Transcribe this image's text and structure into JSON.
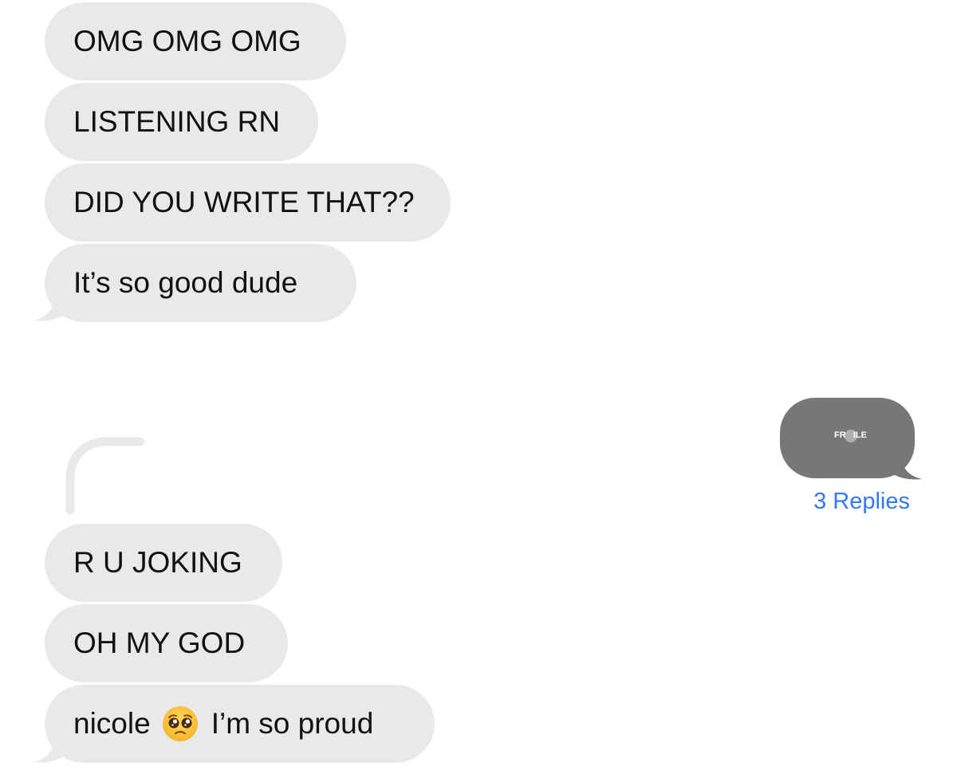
{
  "messages_group_1": [
    {
      "text": "OMG OMG OMG"
    },
    {
      "text": "LISTENING RN"
    },
    {
      "text": "DID YOU WRITE THAT??"
    },
    {
      "text": "It’s so good dude"
    }
  ],
  "sent_media": {
    "thumbnail_text": "FR   ILE",
    "replies_label": "3 Replies"
  },
  "messages_group_2": [
    {
      "text": "R U JOKING"
    },
    {
      "text": "OH MY GOD"
    },
    {
      "text_before_emoji": "nicole",
      "emoji": "pleading-face-emoji",
      "text_after_emoji": "I’m so proud"
    }
  ],
  "colors": {
    "received_bubble": "#e9e9eb",
    "sent_media_bubble": "#777777",
    "link_blue": "#3478f6",
    "thread_line": "#e9e9eb"
  }
}
